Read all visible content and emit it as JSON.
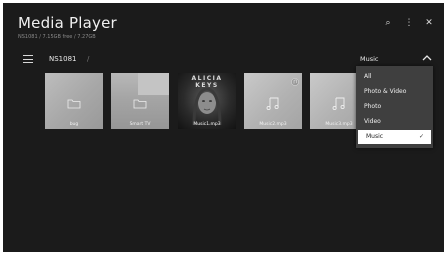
{
  "app": {
    "title": "Media Player",
    "storage_info": "NS1081 / 7.15GB free / 7.27GB"
  },
  "top_bar": {
    "search_glyph": "⌕",
    "more_glyph": "⋮",
    "close_glyph": "✕"
  },
  "nav": {
    "device": "NS1081",
    "separator": "/",
    "filter_value": "Music"
  },
  "tiles": [
    {
      "label": "bug",
      "kind": "folder"
    },
    {
      "label": "Smart TV",
      "kind": "folder"
    },
    {
      "label": "Music1.mp3",
      "kind": "photo-art",
      "banner": "ALICIA KEYS"
    },
    {
      "label": "Music2.mp3",
      "kind": "music"
    },
    {
      "label": "Music3.mp3",
      "kind": "music"
    }
  ],
  "filter_menu": {
    "options": [
      "All",
      "Photo & Video",
      "Photo",
      "Video",
      "Music"
    ],
    "selected": "Music",
    "check_glyph": "✓"
  },
  "colors": {
    "background": "#1b1b1b",
    "menu": "#3f3f3f",
    "selected": "#ffffff"
  }
}
